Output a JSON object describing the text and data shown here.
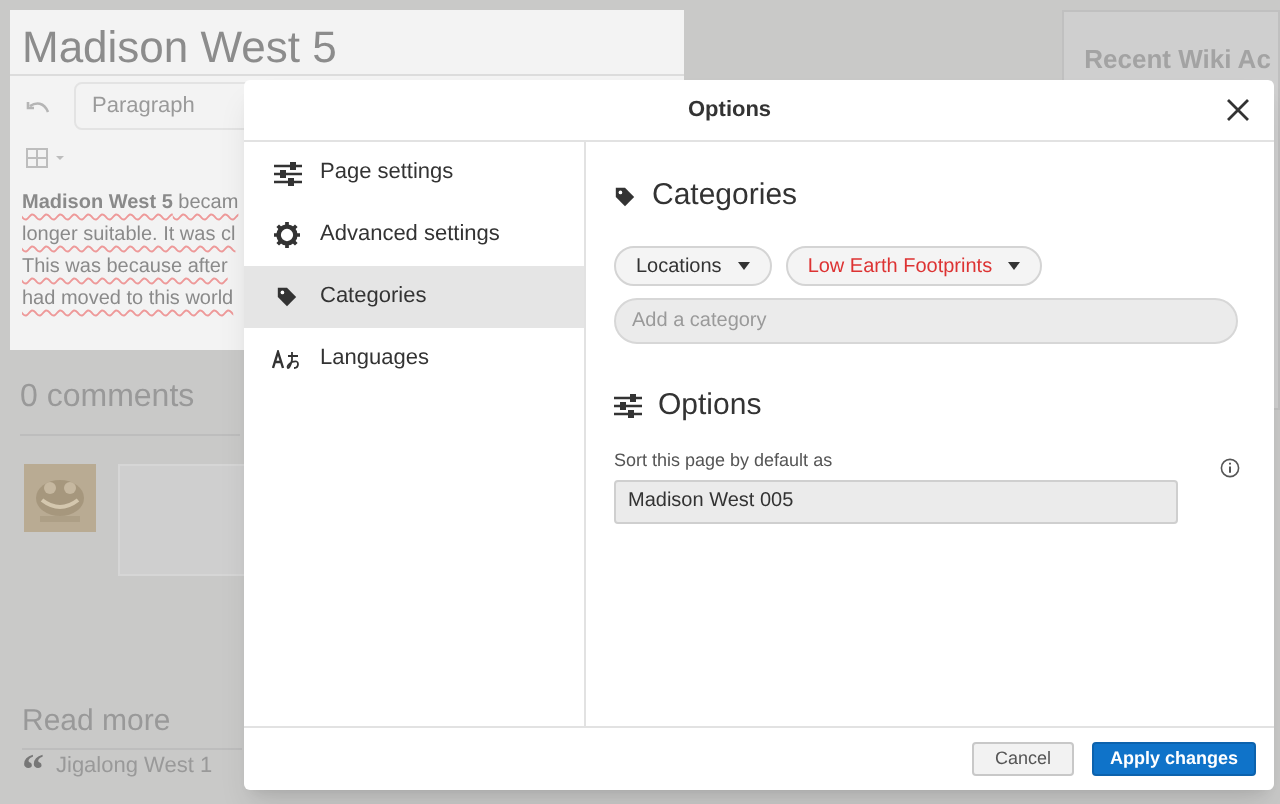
{
  "page": {
    "title": "Madison West 5",
    "toolbar": {
      "format": "Paragraph"
    },
    "body_lines": [
      {
        "text": "**Madison West 5** becam"
      },
      {
        "text": "longer suitable. It was cl"
      },
      {
        "text": "This was because after"
      },
      {
        "text": "had moved to this world"
      }
    ],
    "comments_heading": "0 comments",
    "read_more": "Read more",
    "read_more_items": [
      {
        "mark": "“",
        "text": "Jigalong West 1"
      }
    ],
    "sidebar_heading": "Recent Wiki Ac"
  },
  "dialog": {
    "title": "Options",
    "menu": [
      {
        "label": "Page settings",
        "selected": false
      },
      {
        "label": "Advanced settings",
        "selected": false
      },
      {
        "label": "Categories",
        "selected": true
      },
      {
        "label": "Languages",
        "selected": false
      }
    ],
    "categories": {
      "heading": "Categories",
      "chips": [
        {
          "label": "Locations",
          "missing": false
        },
        {
          "label": "Low Earth Footprints",
          "missing": true
        }
      ],
      "input": {
        "placeholder": "Add a category"
      }
    },
    "options": {
      "heading": "Options",
      "sort_label": "Sort this page by default as",
      "sort_value": "Madison West 005"
    },
    "buttons": [
      {
        "label": "Cancel",
        "kind": "secondary"
      },
      {
        "label": "Apply changes",
        "kind": "primary"
      }
    ]
  }
}
